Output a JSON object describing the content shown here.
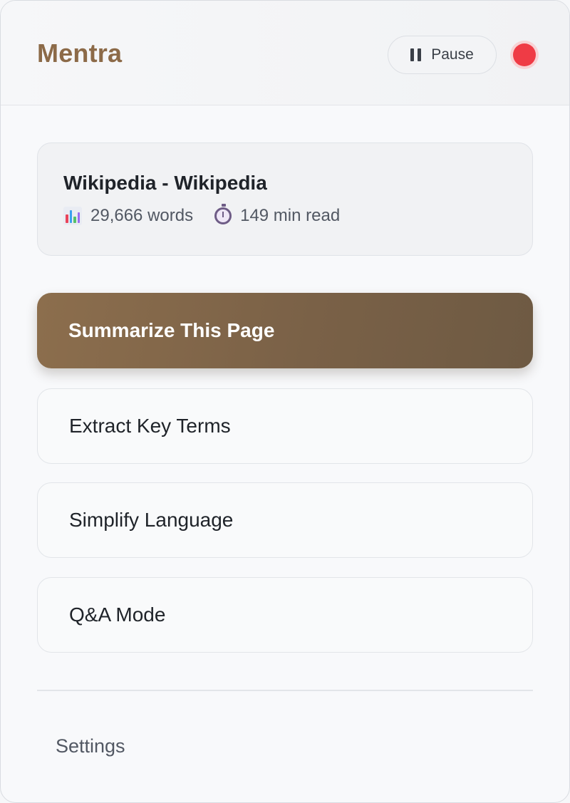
{
  "header": {
    "brand": "Mentra",
    "pause_label": "Pause",
    "status_indicator_color": "#ef3b45"
  },
  "page_info": {
    "title": "Wikipedia - Wikipedia",
    "word_count": "29,666 words",
    "read_time": "149 min read",
    "word_icon": "bar-chart-icon",
    "time_icon": "stopwatch-icon"
  },
  "actions": [
    {
      "label": "Summarize This Page",
      "style": "primary"
    },
    {
      "label": "Extract Key Terms",
      "style": "secondary"
    },
    {
      "label": "Simplify Language",
      "style": "secondary"
    },
    {
      "label": "Q&A Mode",
      "style": "secondary"
    }
  ],
  "footer": {
    "settings_label": "Settings"
  },
  "theme": {
    "brand_color": "#8c6a48",
    "primary_button_color": "#7a6147"
  }
}
